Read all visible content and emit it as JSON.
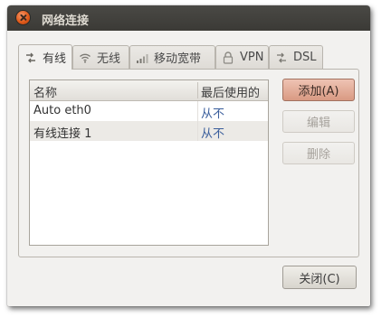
{
  "window": {
    "title": "网络连接"
  },
  "tabs": [
    {
      "label": "有线",
      "icon": "wired-icon"
    },
    {
      "label": "无线",
      "icon": "wireless-icon"
    },
    {
      "label": "移动宽带",
      "icon": "signal-bars-icon"
    },
    {
      "label": "VPN",
      "icon": "lock-icon"
    },
    {
      "label": "DSL",
      "icon": "dsl-icon"
    }
  ],
  "list": {
    "columns": [
      "名称",
      "最后使用的"
    ],
    "rows": [
      {
        "name": "Auto eth0",
        "last_used": "从不"
      },
      {
        "name": "有线连接 1",
        "last_used": "从不"
      }
    ]
  },
  "buttons": {
    "add": "添加(A)",
    "edit": "编辑",
    "delete": "删除",
    "close": "关闭(C)"
  }
}
